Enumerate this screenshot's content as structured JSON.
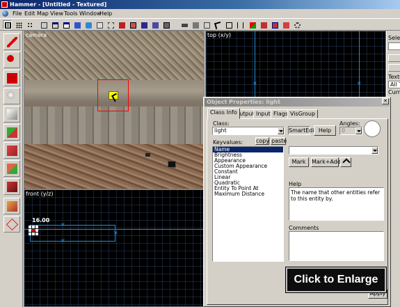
{
  "window": {
    "title": "Hammer - [Untitled - Textured]"
  },
  "menu": [
    "File",
    "Edit",
    "Map",
    "View",
    "Tools",
    "Window",
    "Help"
  ],
  "viewports": {
    "camera": "camera",
    "top": "top (x/y)",
    "front": "front (y/z)",
    "front_size": "16.00"
  },
  "right_panel": {
    "select_label": "Selec",
    "texture_label": "Textur",
    "texture_value": "All T",
    "current_label": "Curren"
  },
  "dialog": {
    "title": "Object Properties: light",
    "tabs": [
      "Class Info",
      "Outputs",
      "Inputs",
      "Flags",
      "VisGroup"
    ],
    "class_label": "Class:",
    "class_value": "light",
    "smartedit": "SmartEdit",
    "help": "Help",
    "angles_label": "Angles:",
    "angles_value": "0",
    "keyvalues_label": "Keyvalues:",
    "copy": "copy",
    "paste": "paste",
    "keyvalues": [
      "Name",
      "Brightness",
      "Appearance",
      "Custom Appearance",
      "Constant",
      "Linear",
      "Quadratic",
      "Entity To Point At",
      "Maximum Distance"
    ],
    "value_field": "",
    "mark": "Mark",
    "mark_add": "Mark+Add",
    "help_label": "Help",
    "help_text": "The name that other entities refer to this entity by.",
    "comments_label": "Comments",
    "comments_text": "",
    "apply": "Apply"
  },
  "overlay": {
    "enlarge": "Click to Enlarge"
  }
}
